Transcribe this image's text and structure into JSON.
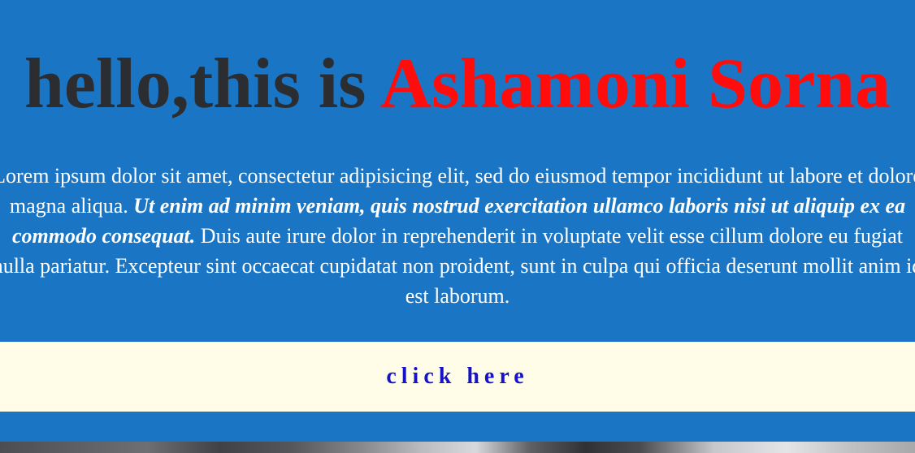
{
  "hero": {
    "title_prefix": "hello,this is ",
    "title_name": "Ashamoni Sorna",
    "paragraph": {
      "part1": "Lorem ipsum dolor sit amet, consectetur adipisicing elit, sed do eiusmod tempor incididunt ut labore et dolore magna aliqua. ",
      "emphasis": "Ut enim ad minim veniam, quis nostrud exercitation ullamco laboris nisi ut aliquip ex ea commodo consequat.",
      "part2": " Duis aute irure dolor in reprehenderit in voluptate velit esse cillum dolore eu fugiat nulla pariatur. Excepteur sint occaecat cupidatat non proident, sunt in culpa qui officia deserunt mollit anim id est laborum."
    }
  },
  "cta": {
    "label": "click here"
  },
  "colors": {
    "background": "#1a76c5",
    "title_prefix": "#2b2d31",
    "title_name": "#ff0d0d",
    "cta_band": "#fffde8",
    "cta_text": "#1512c9"
  }
}
